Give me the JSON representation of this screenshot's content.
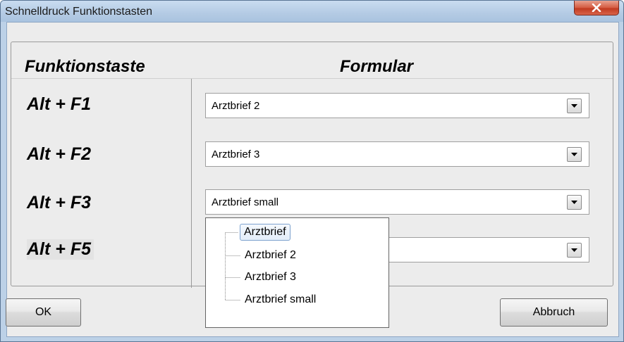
{
  "window": {
    "title": "Schnelldruck Funktionstasten"
  },
  "headers": {
    "key_column": "Funktionstaste",
    "form_column": "Formular"
  },
  "rows": [
    {
      "key": "Alt + F1",
      "form": "Arztbrief 2"
    },
    {
      "key": "Alt + F2",
      "form": "Arztbrief 3"
    },
    {
      "key": "Alt + F3",
      "form": "Arztbrief small"
    },
    {
      "key": "Alt + F5",
      "form": ""
    }
  ],
  "dropdown": {
    "options": [
      "Arztbrief",
      "Arztbrief 2",
      "Arztbrief 3",
      "Arztbrief small"
    ],
    "highlighted": "Arztbrief"
  },
  "buttons": {
    "ok": "OK",
    "cancel": "Abbruch"
  },
  "icons": {
    "close": "close-icon",
    "dropdown_arrow": "chevron-down-icon"
  }
}
